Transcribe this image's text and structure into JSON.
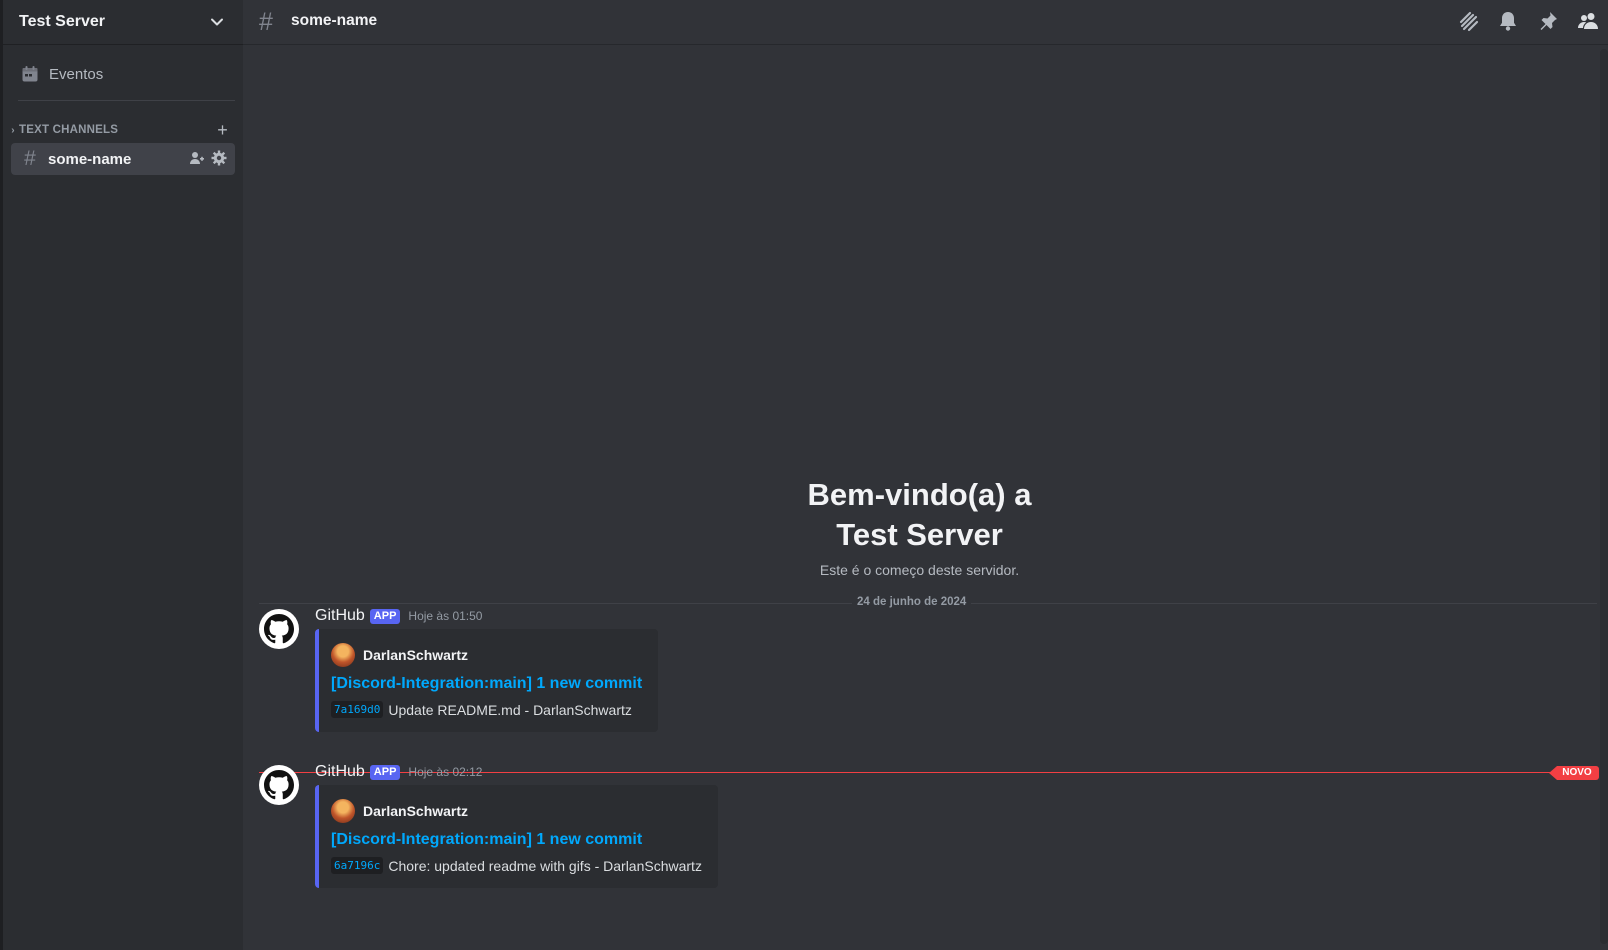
{
  "server": {
    "name": "Test Server",
    "dropdown_icon": "chevron-down-icon"
  },
  "sidebar": {
    "events_label": "Eventos",
    "category_label": "TEXT CHANNELS",
    "channels": [
      {
        "name": "some-name",
        "active": true
      }
    ]
  },
  "topbar": {
    "channel_name": "some-name",
    "tools": [
      "threads-icon",
      "bell-icon",
      "pin-icon",
      "members-icon"
    ]
  },
  "welcome": {
    "line1": "Bem-vindo(a) a",
    "line2": "Test Server",
    "subtitle": "Este é o começo deste servidor."
  },
  "date_divider": "24 de junho de 2024",
  "new_badge": "NOVO",
  "messages": [
    {
      "author": "GitHub",
      "tag": "APP",
      "time": "Hoje às 01:50",
      "embed": {
        "author": "DarlanSchwartz",
        "title": "[Discord-Integration:main] 1 new commit",
        "sha": "7a169d0",
        "text": "Update README.md - DarlanSchwartz"
      }
    },
    {
      "author": "GitHub",
      "tag": "APP",
      "time": "Hoje às 02:12",
      "embed": {
        "author": "DarlanSchwartz",
        "title": "[Discord-Integration:main] 1 new commit",
        "sha": "6a7196c",
        "text": "Chore: updated readme with gifs - DarlanSchwartz"
      }
    }
  ],
  "colors": {
    "accent": "#5865f2",
    "link": "#00a8fc",
    "new": "#f23f43",
    "background": "#313338",
    "sidebar": "#2b2d31"
  }
}
